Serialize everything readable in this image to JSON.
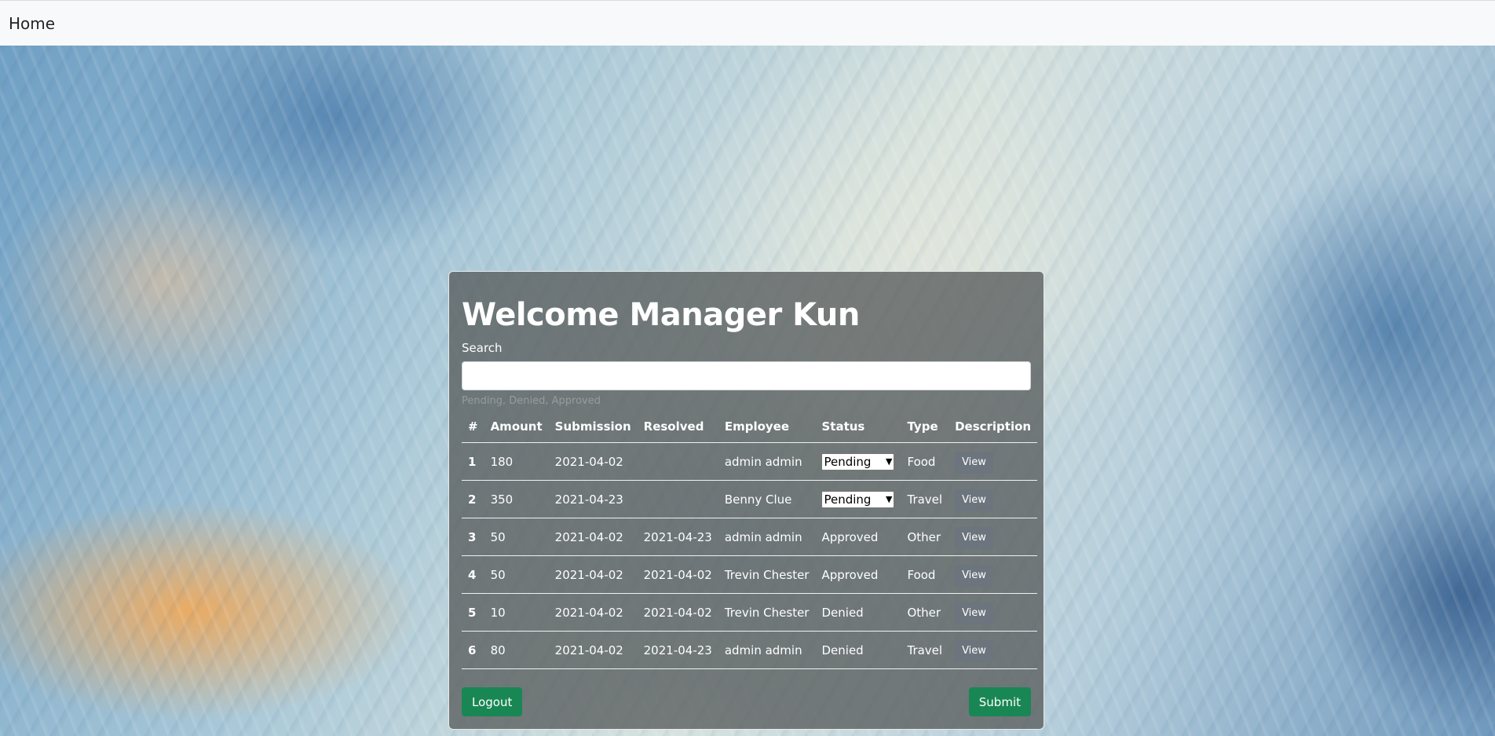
{
  "nav": {
    "brand": "Home"
  },
  "panel": {
    "title": "Welcome Manager Kun",
    "search_label": "Search",
    "search_value": "",
    "search_hint": "Pending, Denied, Approved"
  },
  "table": {
    "headers": [
      "#",
      "Amount",
      "Submission",
      "Resolved",
      "Employee",
      "Status",
      "Type",
      "Description"
    ],
    "rows": [
      {
        "num": "1",
        "amount": "180",
        "submission": "2021-04-02",
        "resolved": "",
        "employee": "admin admin",
        "status": "Pending",
        "status_editable": true,
        "type": "Food",
        "view": "View"
      },
      {
        "num": "2",
        "amount": "350",
        "submission": "2021-04-23",
        "resolved": "",
        "employee": "Benny Clue",
        "status": "Pending",
        "status_editable": true,
        "type": "Travel",
        "view": "View"
      },
      {
        "num": "3",
        "amount": "50",
        "submission": "2021-04-02",
        "resolved": "2021-04-23",
        "employee": "admin admin",
        "status": "Approved",
        "status_editable": false,
        "type": "Other",
        "view": "View"
      },
      {
        "num": "4",
        "amount": "50",
        "submission": "2021-04-02",
        "resolved": "2021-04-02",
        "employee": "Trevin Chester",
        "status": "Approved",
        "status_editable": false,
        "type": "Food",
        "view": "View"
      },
      {
        "num": "5",
        "amount": "10",
        "submission": "2021-04-02",
        "resolved": "2021-04-02",
        "employee": "Trevin Chester",
        "status": "Denied",
        "status_editable": false,
        "type": "Other",
        "view": "View"
      },
      {
        "num": "6",
        "amount": "80",
        "submission": "2021-04-02",
        "resolved": "2021-04-23",
        "employee": "admin admin",
        "status": "Denied",
        "status_editable": false,
        "type": "Travel",
        "view": "View"
      }
    ]
  },
  "buttons": {
    "logout": "Logout",
    "submit": "Submit"
  },
  "colors": {
    "success": "#198754",
    "secondary": "#6c757d",
    "navbar_bg": "#f8f9fa"
  }
}
